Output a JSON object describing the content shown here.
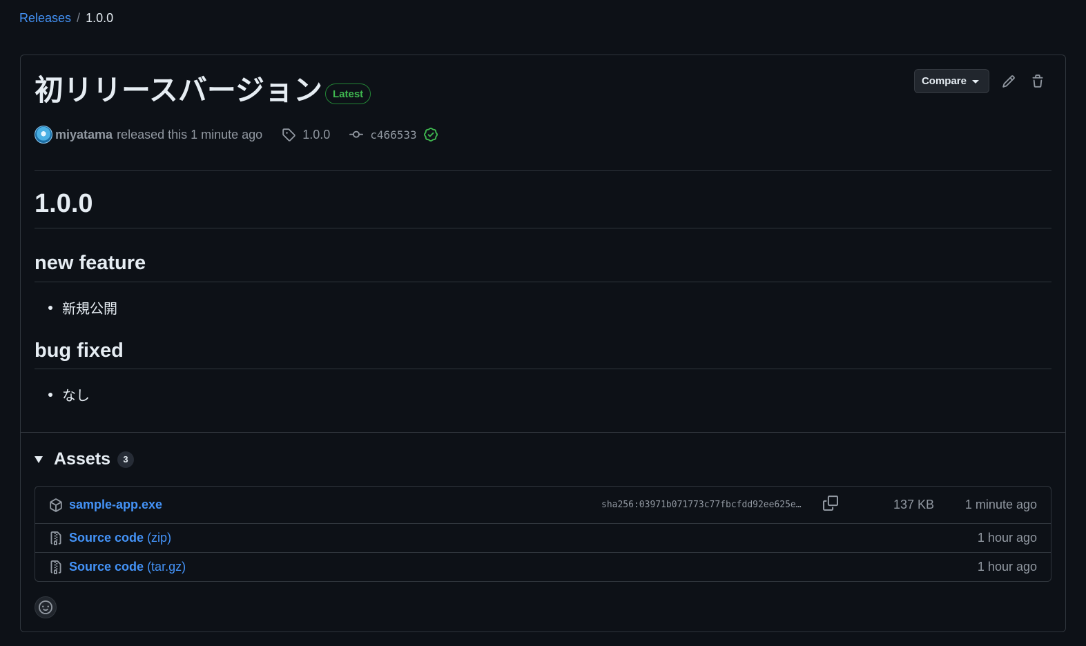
{
  "breadcrumb": {
    "parent": "Releases",
    "separator": "/",
    "current": "1.0.0"
  },
  "release": {
    "title": "初リリースバージョン",
    "badge": "Latest",
    "compare_label": "Compare",
    "author": "miyatama",
    "released_text": "released this 1 minute ago",
    "tag": "1.0.0",
    "commit": "c466533"
  },
  "notes": {
    "h1": "1.0.0",
    "sections": [
      {
        "heading": "new feature",
        "items": [
          "新規公開"
        ]
      },
      {
        "heading": "bug fixed",
        "items": [
          "なし"
        ]
      }
    ]
  },
  "assets": {
    "title": "Assets",
    "count": "3",
    "rows": [
      {
        "name": "sample-app.exe",
        "ext": "",
        "sha": "sha256:03971b071773c77fbcfdd92ee625e…",
        "size": "137 KB",
        "time": "1 minute ago",
        "icon": "package-icon"
      },
      {
        "name": "Source code",
        "ext": "(zip)",
        "sha": "",
        "size": "",
        "time": "1 hour ago",
        "icon": "file-zip-icon"
      },
      {
        "name": "Source code",
        "ext": "(tar.gz)",
        "sha": "",
        "size": "",
        "time": "1 hour ago",
        "icon": "file-zip-icon"
      }
    ]
  },
  "colors": {
    "accent": "#4493f8",
    "success": "#3fb950",
    "background": "#0d1117",
    "border": "#30363d"
  }
}
